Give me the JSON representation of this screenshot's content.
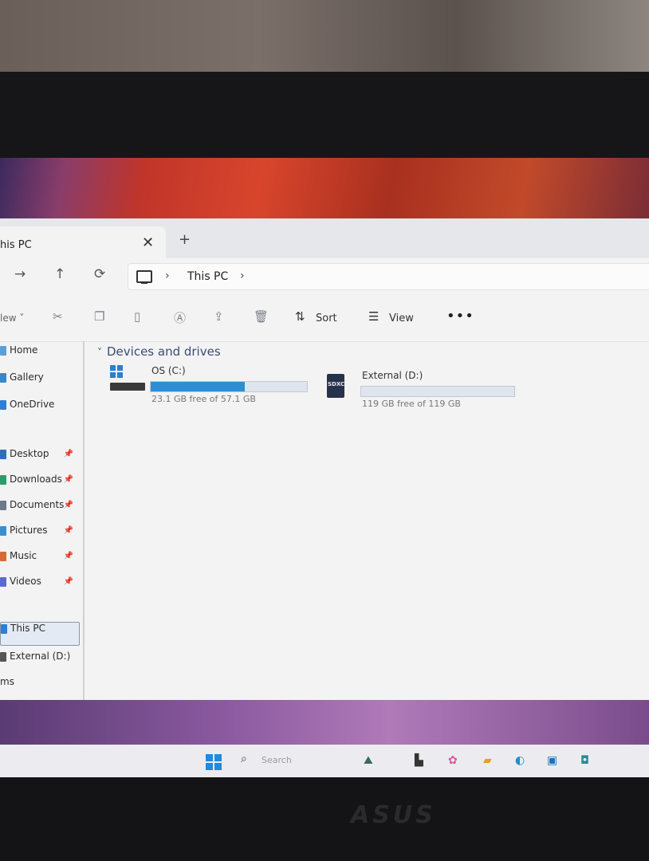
{
  "tab": {
    "title": "his PC",
    "close": "✕",
    "new": "+"
  },
  "nav": {
    "back": "←",
    "forward": "→",
    "up": "↑",
    "refresh": "⟳"
  },
  "address": {
    "crumb": "This PC",
    "sep": "›"
  },
  "toolbar": {
    "new_label": "lew ˅",
    "sort_label": "Sort",
    "view_label": "View",
    "more": "•••",
    "icons": [
      "cut-icon",
      "copy-icon",
      "paste-icon",
      "rename-icon",
      "share-icon",
      "delete-icon"
    ]
  },
  "sidebar": {
    "items": [
      {
        "label": "Home",
        "icon": "home-icon",
        "color": "#5aa0d8"
      },
      {
        "label": "Gallery",
        "icon": "gallery-icon",
        "color": "#3b86c9"
      },
      {
        "label": "OneDrive",
        "icon": "cloud-icon",
        "color": "#2f7fd0"
      },
      {
        "label": "Desktop",
        "icon": "desktop-icon",
        "color": "#2f6fb8",
        "pinned": true
      },
      {
        "label": "Downloads",
        "icon": "download-icon",
        "color": "#2a9d6a",
        "pinned": true
      },
      {
        "label": "Documents",
        "icon": "documents-icon",
        "color": "#6b7b8c",
        "pinned": true
      },
      {
        "label": "Pictures",
        "icon": "pictures-icon",
        "color": "#3a8fd0",
        "pinned": true
      },
      {
        "label": "Music",
        "icon": "music-icon",
        "color": "#d86a3a",
        "pinned": true
      },
      {
        "label": "Videos",
        "icon": "videos-icon",
        "color": "#5a6ad0",
        "pinned": true
      },
      {
        "label": "This PC",
        "icon": "pc-icon",
        "color": "#2b7fd4",
        "selected": true
      },
      {
        "label": "External  (D:)",
        "icon": "drive-icon",
        "color": "#555"
      },
      {
        "label": "ms",
        "icon": "",
        "color": "#555"
      }
    ]
  },
  "content": {
    "section_title": "Devices and drives",
    "drives": [
      {
        "name": "OS (C:)",
        "free_text": "23.1 GB free of 57.1 GB",
        "used_fraction": 0.6
      },
      {
        "name": "External  (D:)",
        "free_text": "119 GB free of 119 GB",
        "used_fraction": 0.0,
        "badge": "SDXC"
      }
    ]
  },
  "taskbar": {
    "search_placeholder": "Search",
    "brand": "ASUS"
  }
}
